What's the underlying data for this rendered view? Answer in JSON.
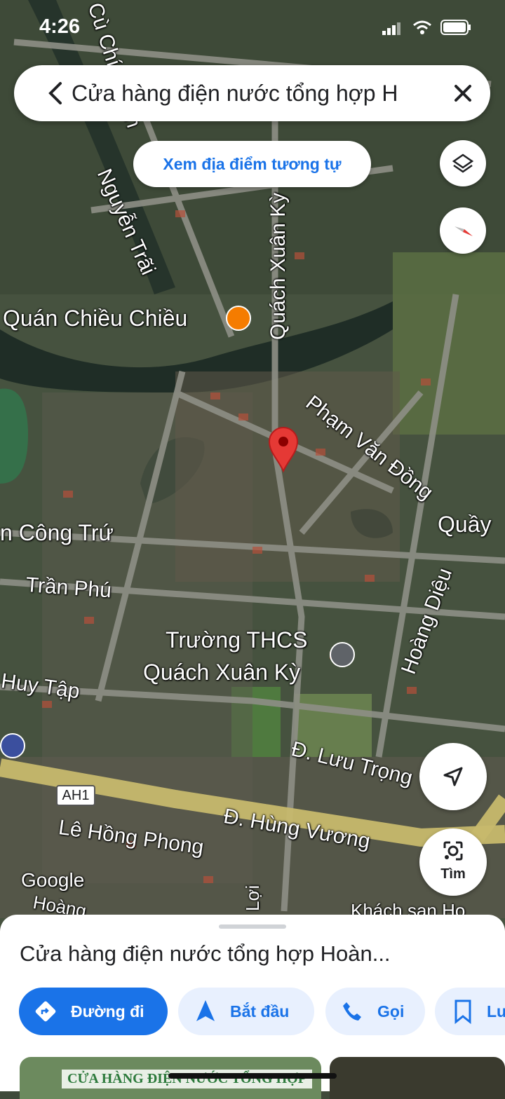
{
  "status_bar": {
    "time": "4:26"
  },
  "search": {
    "query": "Cửa hàng điện nước tổng hợp H"
  },
  "suggestion_chip": "Xem địa điểm tương tự",
  "map": {
    "streets": {
      "cu_chinh_lan": "Cù Chính Lan",
      "nguyen_trai": "Nguyễn Trãi",
      "quach_xuan_ky": "Quách Xuân Kỳ",
      "pham_van_dong": "Phạm Văn Đồng",
      "cong_tru": "n Công Trứ",
      "tran_phu": "Trần Phú",
      "hoang_dieu": "Hoàng Diệu",
      "huy_tap": "Huy Tập",
      "luu_trong": "Đ. Lưu Trọng",
      "hung_vuong": "Đ. Hùng Vương",
      "le_hong_phong": "Lê Hồng Phong",
      "hoang": "Hoàng",
      "loi": "Lợi",
      "khach_san": "Khách sạn Ho"
    },
    "places": {
      "quan_chieu_chieu": "Quán Chiều Chiều",
      "school_line1": "Trường THCS",
      "school_line2": "Quách Xuân Kỳ",
      "quay": "Quầy"
    },
    "route_shield": "AH1",
    "watermark": "Google",
    "colors": {
      "pin": "#e53935",
      "restaurant": "#f57c00",
      "school": "#5f6368",
      "parking": "#3b4f9e"
    }
  },
  "lens_button": "Tìm",
  "sheet": {
    "title": "Cửa hàng điện nước tổng hợp Hoàn...",
    "actions": {
      "directions": "Đường đi",
      "start": "Bắt đầu",
      "call": "Gọi",
      "save": "Lư"
    },
    "photo_caption": "CỬA HÀNG ĐIỆN NƯỚC TỔNG HỢP"
  },
  "icons": [
    "back-arrow-icon",
    "close-icon",
    "layers-icon",
    "compass-icon",
    "my-location-icon",
    "google-lens-icon",
    "directions-icon",
    "navigation-arrow-icon",
    "phone-icon",
    "bookmark-icon",
    "restaurant-icon",
    "school-icon",
    "parking-icon",
    "map-pin-icon",
    "signal-icon",
    "wifi-icon",
    "battery-icon"
  ]
}
